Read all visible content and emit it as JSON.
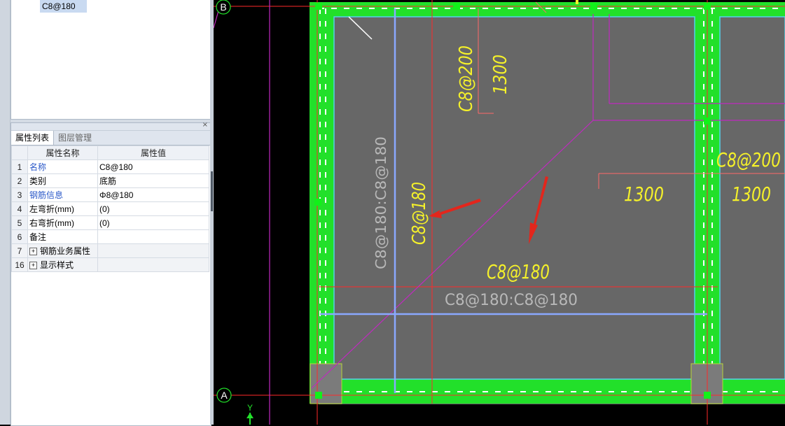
{
  "tree": {
    "selected_item": "C8@180"
  },
  "panel": {
    "close_glyph": "×",
    "tabs": [
      "属性列表",
      "图层管理"
    ],
    "headers": {
      "name": "属性名称",
      "value": "属性值"
    },
    "rows": [
      {
        "num": "1",
        "name": "名称",
        "value": "C8@180"
      },
      {
        "num": "2",
        "name": "类别",
        "value": "底筋"
      },
      {
        "num": "3",
        "name": "钢筋信息",
        "value": "Φ8@180"
      },
      {
        "num": "4",
        "name": "左弯折(mm)",
        "value": "(0)"
      },
      {
        "num": "5",
        "name": "右弯折(mm)",
        "value": "(0)"
      },
      {
        "num": "6",
        "name": "备注",
        "value": ""
      },
      {
        "num": "7",
        "name": "钢筋业务属性",
        "value": ""
      },
      {
        "num": "16",
        "name": "显示样式",
        "value": ""
      }
    ],
    "expand_glyph": "+"
  },
  "drawing": {
    "axis_b": "B",
    "axis_a": "A",
    "y_axis": "Y",
    "labels": {
      "c8_200_left": "C8@200",
      "dim_1300_left": "1300",
      "c8_200_right": "C8@200",
      "dim_1300_mid": "1300",
      "dim_1300_right": "1300",
      "c8_180_vertical": "C8@180",
      "gray_vertical": "C8@180:C8@180",
      "c8_180_horizontal": "C8@180",
      "gray_horizontal": "C8@180:C8@180"
    },
    "colors": {
      "beam": "#22e02a",
      "slab": "#676767",
      "rebar_label": "#f5f12a",
      "gray_label": "#b8b8b8",
      "rebar_line": "#8aa8ff",
      "axis": "#ff2a2a",
      "magenta": "#c02ac0",
      "arrow": "#e3261c"
    }
  }
}
